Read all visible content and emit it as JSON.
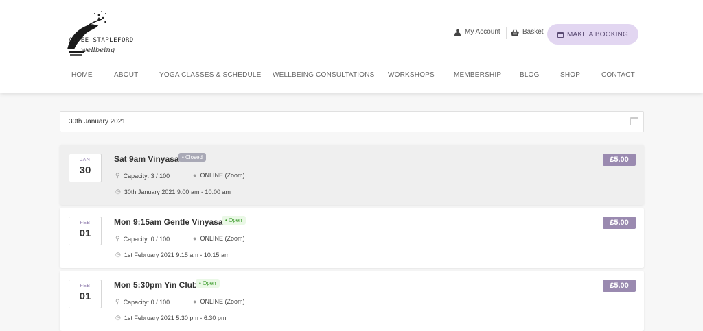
{
  "brand": {
    "line1": "AIMEE STAPLEFORD",
    "line2": "wellbeing"
  },
  "header": {
    "account_label": "My Account",
    "basket_label": "Basket",
    "booking_label": "MAKE A BOOKING"
  },
  "nav": {
    "items": [
      {
        "label": "HOME"
      },
      {
        "label": "ABOUT"
      },
      {
        "label": "YOGA CLASSES & SCHEDULE"
      },
      {
        "label": "WELLBEING CONSULTATIONS"
      },
      {
        "label": "WORKSHOPS"
      },
      {
        "label": "MEMBERSHIP"
      },
      {
        "label": "BLOG"
      },
      {
        "label": "SHOP"
      },
      {
        "label": "CONTACT"
      }
    ]
  },
  "date_filter": {
    "value": "30th January 2021"
  },
  "events": [
    {
      "month": "JAN",
      "day": "30",
      "title": "Sat 9am Vinyasa",
      "status": "• Closed",
      "capacity": "Capacity: 3 / 100",
      "location": "ONLINE (Zoom)",
      "time": "30th January 2021 9:00 am - 10:00 am",
      "price": "£5.00"
    },
    {
      "month": "FEB",
      "day": "01",
      "title": "Mon 9:15am Gentle Vinyasa",
      "status": "• Open",
      "capacity": "Capacity: 0 / 100",
      "location": "ONLINE (Zoom)",
      "time": "1st February 2021 9:15 am - 10:15 am",
      "price": "£5.00"
    },
    {
      "month": "FEB",
      "day": "01",
      "title": "Mon 5:30pm Yin Club",
      "status": "• Open",
      "capacity": "Capacity: 0 / 100",
      "location": "ONLINE (Zoom)",
      "time": "1st February 2021 5:30 pm - 6:30 pm",
      "price": "£5.00"
    }
  ]
}
